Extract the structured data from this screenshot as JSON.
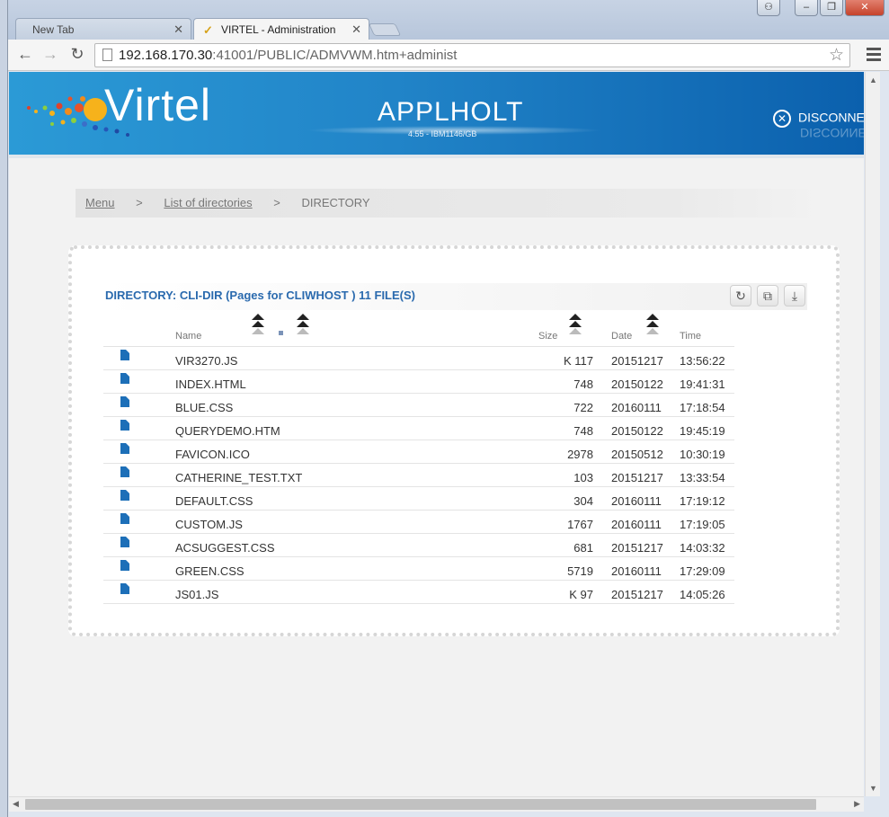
{
  "browser": {
    "tabs": [
      {
        "title": "New Tab"
      },
      {
        "title": "VIRTEL - Administration"
      }
    ],
    "url_host": "192.168.170.30",
    "url_rest": ":41001/PUBLIC/ADMVWM.htm+administ",
    "window_buttons": {
      "minimize": "–",
      "restore": "❐",
      "close": "✕"
    }
  },
  "banner": {
    "brand": "Virtel",
    "app_title": "APPLHOLT",
    "app_version": "4.55 - IBM1146/GB",
    "disconnect_label": "DISCONNEC",
    "accent_start": "#2b9ad6",
    "accent_end": "#0b60ad"
  },
  "breadcrumb": {
    "menu": "Menu",
    "list": "List of directories",
    "current": "DIRECTORY",
    "separator": ">"
  },
  "directory": {
    "title": "DIRECTORY: CLI-DIR (Pages for CLIWHOST ) 11 FILE(S)",
    "columns": {
      "name": "Name",
      "size": "Size",
      "date": "Date",
      "time": "Time"
    },
    "files": [
      {
        "name": "VIR3270.JS",
        "size": "K 117",
        "date": "20151217",
        "time": "13:56:22"
      },
      {
        "name": "INDEX.HTML",
        "size": "748",
        "date": "20150122",
        "time": "19:41:31"
      },
      {
        "name": "BLUE.CSS",
        "size": "722",
        "date": "20160111",
        "time": "17:18:54"
      },
      {
        "name": "QUERYDEMO.HTM",
        "size": "748",
        "date": "20150122",
        "time": "19:45:19"
      },
      {
        "name": "FAVICON.ICO",
        "size": "2978",
        "date": "20150512",
        "time": "10:30:19"
      },
      {
        "name": "CATHERINE_TEST.TXT",
        "size": "103",
        "date": "20151217",
        "time": "13:33:54"
      },
      {
        "name": "DEFAULT.CSS",
        "size": "304",
        "date": "20160111",
        "time": "17:19:12"
      },
      {
        "name": "CUSTOM.JS",
        "size": "1767",
        "date": "20160111",
        "time": "17:19:05"
      },
      {
        "name": "ACSUGGEST.CSS",
        "size": "681",
        "date": "20151217",
        "time": "14:03:32"
      },
      {
        "name": "GREEN.CSS",
        "size": "5719",
        "date": "20160111",
        "time": "17:29:09"
      },
      {
        "name": "JS01.JS",
        "size": "K 97",
        "date": "20151217",
        "time": "14:05:26"
      }
    ]
  }
}
